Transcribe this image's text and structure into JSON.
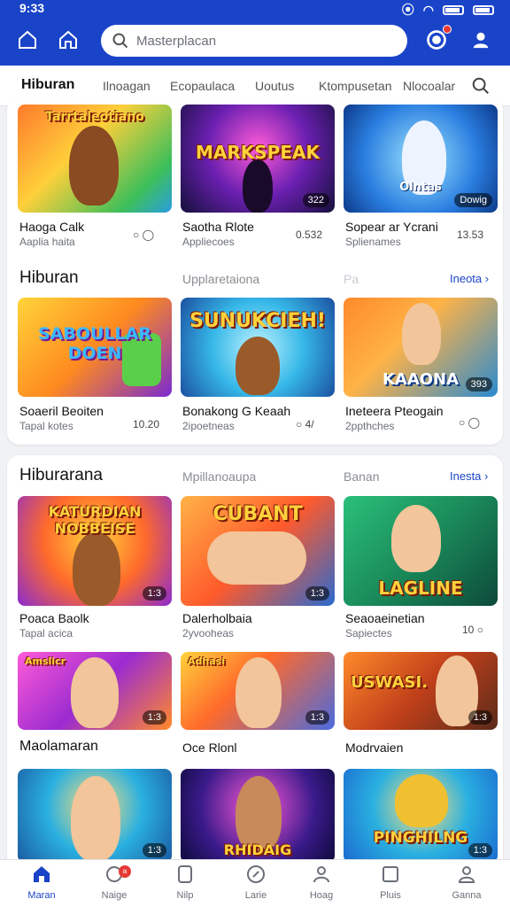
{
  "status": {
    "time": "9:33"
  },
  "search": {
    "placeholder": "Masterplacan"
  },
  "tabs": [
    {
      "label": "Hiburan",
      "active": true
    },
    {
      "label": "Ilnoagan"
    },
    {
      "label": "Ecopaulaca"
    },
    {
      "label": "Uoutus"
    },
    {
      "label": "Ktompusetan"
    },
    {
      "label": "Nlocoalar"
    }
  ],
  "sections": {
    "row1": [
      {
        "art": "Tarrtaleotiano",
        "title": "Haoga Calk",
        "sub": "Aaplia haita",
        "meta": ""
      },
      {
        "art": "MARKSPEAK",
        "title": "Saotha Rlote",
        "sub": "Appliecoes",
        "meta": "0.532",
        "rating": "322"
      },
      {
        "art": "Olntas",
        "title": "Sopear ar Ycrani",
        "sub": "Splienames",
        "meta": "13.53",
        "rating": "Dowig"
      }
    ],
    "hiburan": {
      "title": "Hiburan",
      "mid": "Upplaretaiona",
      "mid2": "Pa",
      "more": "Ineota",
      "items": [
        {
          "art": "SABOULLAR DOEN",
          "title": "Soaeril Beoiten",
          "sub": "Tapal kotes",
          "meta": "10.20"
        },
        {
          "art": "SUNUKCIEH!",
          "title": "Bonakong G Keaah",
          "sub": "2ipoetneas",
          "meta": "4/"
        },
        {
          "art": "KAAONA",
          "title": "Ineteera Pteogain",
          "sub": "2ppthches",
          "meta": "",
          "rating": "393"
        }
      ]
    },
    "hiburarana": {
      "title": "Hiburarana",
      "mid": "Mpillanoaupa",
      "mid2": "Banan",
      "more": "Inesta",
      "items": [
        {
          "art": "KATURDIAN NOBBEISE",
          "title": "Poaca Baolk",
          "sub": "Tapal acica",
          "meta": "",
          "rating": "1:3"
        },
        {
          "art": "CUBANT",
          "title": "Dalerholbaia",
          "sub": "2yvooheas",
          "meta": "",
          "rating": "1:3"
        },
        {
          "art": "LAGLINE",
          "title": "Seaoaeinetian",
          "sub": "Sapiectes",
          "meta": "10"
        }
      ],
      "items2": [
        {
          "art": "Amslicr",
          "rating": "1:3"
        },
        {
          "art": "Adhasi",
          "rating": "1:3"
        },
        {
          "art": "USWASI.",
          "rating": "1:3"
        }
      ]
    },
    "row4": {
      "labels": [
        "Maolamaran",
        "Oce Rlonl",
        "Modrvaien"
      ],
      "items": [
        {
          "art": "",
          "rating": "1:3"
        },
        {
          "art": "RHIDAIG",
          "rating": ""
        },
        {
          "art": "PINGHILNG",
          "rating": "1:3"
        }
      ]
    }
  },
  "bottomnav": [
    {
      "label": "Maran",
      "icon": "home-icon",
      "active": true
    },
    {
      "label": "Naige",
      "icon": "chat-icon",
      "badge": "a"
    },
    {
      "label": "Nilp",
      "icon": "tablet-icon"
    },
    {
      "label": "Larie",
      "icon": "compass-icon"
    },
    {
      "label": "Hoag",
      "icon": "user-icon"
    },
    {
      "label": "Pluis",
      "icon": "grid-icon"
    },
    {
      "label": "Ganna",
      "icon": "profile-icon"
    }
  ],
  "colors": {
    "brand": "#1a44c8",
    "badge": "#e53935"
  }
}
